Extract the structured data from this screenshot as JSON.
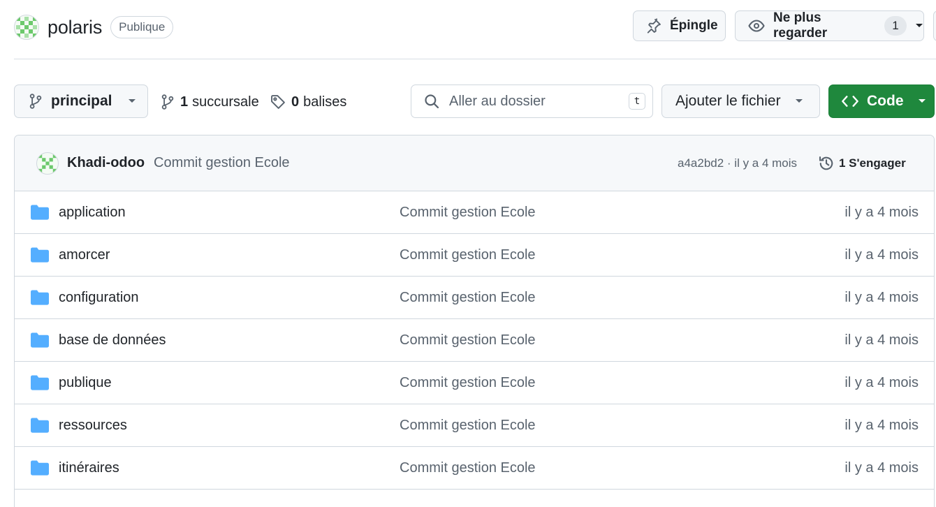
{
  "repo": {
    "name": "polaris",
    "visibility": "Publique"
  },
  "actions": {
    "pin_label": "Épingle",
    "watch_label": "Ne plus regarder",
    "watch_count": "1"
  },
  "toolbar": {
    "branch": "principal",
    "branches_count": "1",
    "branches_label": "succursale",
    "tags_count": "0",
    "tags_label": "balises",
    "search_placeholder": "Aller au dossier",
    "search_shortcut": "t",
    "add_file_label": "Ajouter le fichier",
    "code_label": "Code"
  },
  "latest_commit": {
    "author": "Khadi-odoo",
    "message": "Commit gestion Ecole",
    "hash_time": "a4a2bd2 · il y a 4 mois",
    "history_label": "1 S'engager"
  },
  "files": [
    {
      "name": "application",
      "commit": "Commit gestion Ecole",
      "date": "il y a 4 mois",
      "icon": "folder-icon"
    },
    {
      "name": "amorcer",
      "commit": "Commit gestion Ecole",
      "date": "il y a 4 mois",
      "icon": "folder-icon"
    },
    {
      "name": "configuration",
      "commit": "Commit gestion Ecole",
      "date": "il y a 4 mois",
      "icon": "folder-icon"
    },
    {
      "name": "base de données",
      "commit": "Commit gestion Ecole",
      "date": "il y a 4 mois",
      "icon": "folder-icon"
    },
    {
      "name": "publique",
      "commit": "Commit gestion Ecole",
      "date": "il y a 4 mois",
      "icon": "folder-icon"
    },
    {
      "name": "ressources",
      "commit": "Commit gestion Ecole",
      "date": "il y a 4 mois",
      "icon": "folder-icon"
    },
    {
      "name": "itinéraires",
      "commit": "Commit gestion Ecole",
      "date": "il y a 4 mois",
      "icon": "folder-icon"
    }
  ],
  "colors": {
    "primary_green": "#1f883d",
    "folder_blue": "#54aeff",
    "border": "#d0d7de",
    "muted_text": "#59636e"
  }
}
